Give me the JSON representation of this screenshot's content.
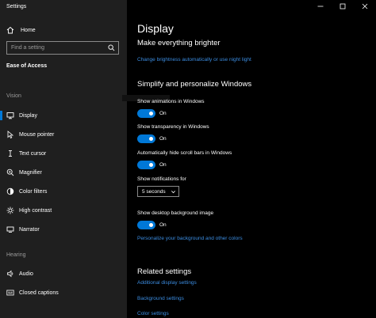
{
  "window": {
    "title": "Settings"
  },
  "sidebar": {
    "home_label": "Home",
    "search_placeholder": "Find a setting",
    "section_title": "Ease of Access",
    "vision_label": "Vision",
    "vision_items": [
      {
        "label": "Display",
        "icon": "display-icon"
      },
      {
        "label": "Mouse pointer",
        "icon": "mouse-pointer-icon"
      },
      {
        "label": "Text cursor",
        "icon": "text-cursor-icon"
      },
      {
        "label": "Magnifier",
        "icon": "magnifier-icon"
      },
      {
        "label": "Color filters",
        "icon": "color-filters-icon"
      },
      {
        "label": "High contrast",
        "icon": "high-contrast-icon"
      },
      {
        "label": "Narrator",
        "icon": "narrator-icon"
      }
    ],
    "hearing_label": "Hearing",
    "hearing_items": [
      {
        "label": "Audio",
        "icon": "audio-icon"
      },
      {
        "label": "Closed captions",
        "icon": "closed-captions-icon"
      }
    ],
    "selected": "Display"
  },
  "main": {
    "title": "Display",
    "brighter_heading": "Make everything brighter",
    "brightness_link": "Change brightness automatically or use night light",
    "simplify_heading": "Simplify and personalize Windows",
    "animations_label": "Show animations in Windows",
    "animations_state": "On",
    "transparency_label": "Show transparency in Windows",
    "transparency_state": "On",
    "scrollbars_label": "Automatically hide scroll bars in Windows",
    "scrollbars_state": "On",
    "notifications_label": "Show notifications for",
    "notifications_value": "5 seconds",
    "background_label": "Show desktop background image",
    "background_state": "On",
    "personalize_link": "Personalize your background and other colors",
    "related_heading": "Related settings",
    "related_links": [
      "Additional display settings",
      "Background settings",
      "Color settings"
    ]
  },
  "colors": {
    "accent": "#0078d7",
    "link": "#3b8ce0",
    "sidebar_bg": "#1f1f1f",
    "main_bg": "#000000"
  }
}
